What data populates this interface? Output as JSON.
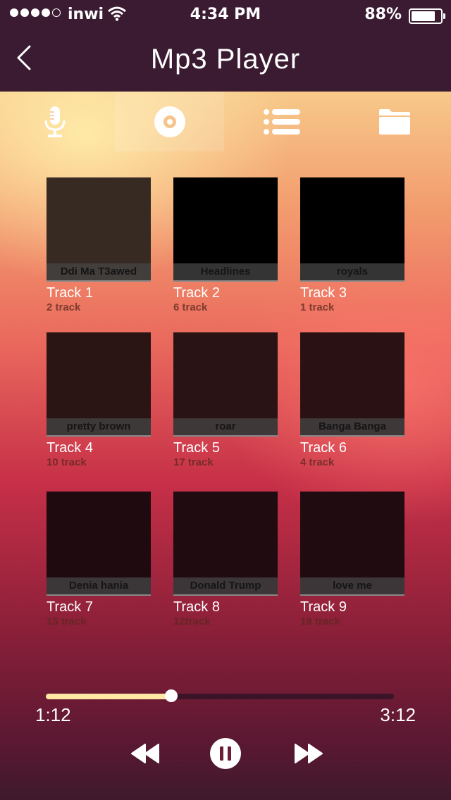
{
  "status_bar": {
    "carrier": "inwi",
    "time": "4:34 PM",
    "battery": "88%",
    "battery_level": 0.88,
    "signal_bars": 4
  },
  "header": {
    "title": "Mp3 Player"
  },
  "tabs": [
    {
      "icon": "microphone-icon",
      "active": false
    },
    {
      "icon": "disc-icon",
      "active": true
    },
    {
      "icon": "list-icon",
      "active": false
    },
    {
      "icon": "folder-icon",
      "active": false
    }
  ],
  "albums": [
    {
      "cover_label": "Ddi Ma T3awed",
      "name": "Track 1",
      "count": "2 track",
      "color": "#372a22"
    },
    {
      "cover_label": "Headlines",
      "name": "Track 2",
      "count": "6 track",
      "color": "#000000"
    },
    {
      "cover_label": "royals",
      "name": "Track 3",
      "count": "1 track",
      "color": "#000000"
    },
    {
      "cover_label": "pretty brown",
      "name": "Track 4",
      "count": "10 track",
      "color": "#2a1414"
    },
    {
      "cover_label": "roar",
      "name": "Track 5",
      "count": "17 track",
      "color": "#2a1315"
    },
    {
      "cover_label": "Banga Banga",
      "name": "Track 6",
      "count": "4 track",
      "color": "#2a1214"
    },
    {
      "cover_label": "Denia hania",
      "name": "Track 7",
      "count": "15 track",
      "color": "#1f0a0f"
    },
    {
      "cover_label": "Donald Trump",
      "name": "Track 8",
      "count": "12track",
      "color": "#200b10"
    },
    {
      "cover_label": "love me",
      "name": "Track 9",
      "count": "19 track",
      "color": "#200b10"
    }
  ],
  "player": {
    "elapsed": "1:12",
    "total": "3:12",
    "progress": 0.36,
    "controls": [
      "rewind-icon",
      "pause-icon",
      "fast-forward-icon"
    ]
  }
}
